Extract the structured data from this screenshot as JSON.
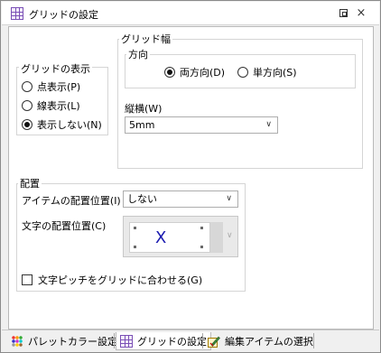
{
  "window": {
    "title": "グリッドの設定",
    "restore_icon": "restore-icon",
    "close_icon": "close-icon",
    "close_glyph": "×"
  },
  "grid_display": {
    "label": "グリッドの表示",
    "options": [
      {
        "label": "点表示(P)",
        "checked": false
      },
      {
        "label": "線表示(L)",
        "checked": false
      },
      {
        "label": "表示しない(N)",
        "checked": true
      }
    ]
  },
  "grid_width": {
    "label": "グリッド幅",
    "direction": {
      "label": "方向",
      "options": [
        {
          "label": "両方向(D)",
          "checked": true
        },
        {
          "label": "単方向(S)",
          "checked": false
        }
      ]
    },
    "size": {
      "label": "縦横(W)",
      "value": "5mm"
    }
  },
  "placement": {
    "label": "配置",
    "item_position": {
      "label": "アイテムの配置位置(I)",
      "value": "しない"
    },
    "text_position": {
      "label": "文字の配置位置(C)",
      "preview_char": "X"
    },
    "pitch_checkbox": {
      "label": "文字ピッチをグリッドに合わせる(G)",
      "checked": false
    }
  },
  "tabs": [
    {
      "label": "パレットカラー設定",
      "icon": "palette-icon",
      "active": false
    },
    {
      "label": "グリッドの設定",
      "icon": "grid-icon",
      "active": true
    },
    {
      "label": "編集アイテムの選択",
      "icon": "edit-select-icon",
      "active": false
    }
  ],
  "dropdown_glyph": "∨"
}
